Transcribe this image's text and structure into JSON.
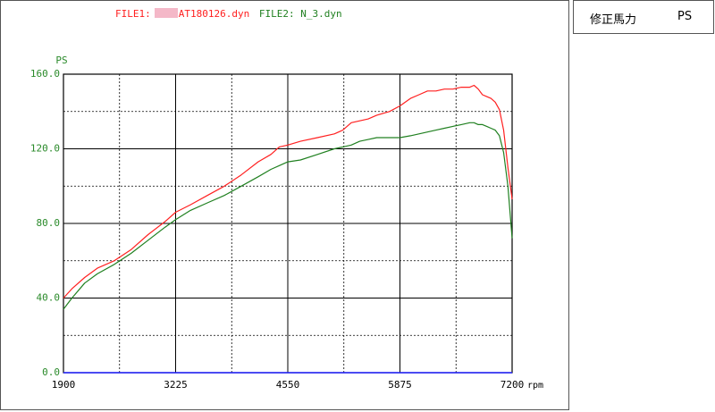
{
  "header": {
    "file1_label": "FILE1:",
    "file1_name": "AT180126.dyn",
    "file2_label": "FILE2:",
    "file2_name": "N_3.dyn",
    "file1_color": "#ff2020",
    "file2_color": "#208020"
  },
  "legend": {
    "label": "修正馬力",
    "unit": "PS"
  },
  "chart_data": {
    "type": "line",
    "ylabel": "PS",
    "xunit": "rpm",
    "xlim": [
      1900,
      7200
    ],
    "ylim": [
      0,
      160
    ],
    "xticks": [
      "1900",
      "3225",
      "4550",
      "5875",
      "7200"
    ],
    "yticks": [
      "0.0",
      "40.0",
      "80.0",
      "120.0",
      "160.0"
    ],
    "grid": true,
    "axis_color": "#2a8a2a",
    "series": [
      {
        "name": "AT180126.dyn",
        "color": "#ff2020",
        "x": [
          1900,
          2000,
          2150,
          2300,
          2500,
          2700,
          2900,
          3100,
          3225,
          3400,
          3600,
          3800,
          4000,
          4200,
          4350,
          4450,
          4550,
          4700,
          4900,
          5100,
          5200,
          5300,
          5400,
          5500,
          5600,
          5750,
          5875,
          6000,
          6100,
          6200,
          6300,
          6400,
          6500,
          6600,
          6700,
          6750,
          6800,
          6850,
          6900,
          6950,
          7000,
          7050,
          7100,
          7150,
          7200
        ],
        "y": [
          40,
          45,
          51,
          56,
          60,
          66,
          74,
          81,
          86,
          90,
          95,
          100,
          106,
          113,
          117,
          121,
          122,
          124,
          126,
          128,
          130,
          134,
          135,
          136,
          138,
          140,
          143,
          147,
          149,
          151,
          151,
          152,
          152,
          153,
          153,
          154,
          152,
          149,
          148,
          147,
          145,
          141,
          130,
          110,
          93
        ]
      },
      {
        "name": "N_3.dyn",
        "color": "#208020",
        "x": [
          1900,
          2000,
          2150,
          2300,
          2500,
          2700,
          2900,
          3100,
          3225,
          3400,
          3600,
          3800,
          4000,
          4200,
          4350,
          4450,
          4550,
          4700,
          4900,
          5100,
          5200,
          5300,
          5400,
          5500,
          5600,
          5750,
          5875,
          6000,
          6100,
          6200,
          6300,
          6400,
          6500,
          6600,
          6700,
          6750,
          6800,
          6850,
          6900,
          6950,
          7000,
          7050,
          7100,
          7150,
          7200
        ],
        "y": [
          34,
          40,
          48,
          53,
          58,
          64,
          71,
          78,
          82,
          87,
          91,
          95,
          100,
          105,
          109,
          111,
          113,
          114,
          117,
          120,
          121,
          122,
          124,
          125,
          126,
          126,
          126,
          127,
          128,
          129,
          130,
          131,
          132,
          133,
          134,
          134,
          133,
          133,
          132,
          131,
          130,
          127,
          118,
          100,
          72
        ]
      }
    ]
  }
}
